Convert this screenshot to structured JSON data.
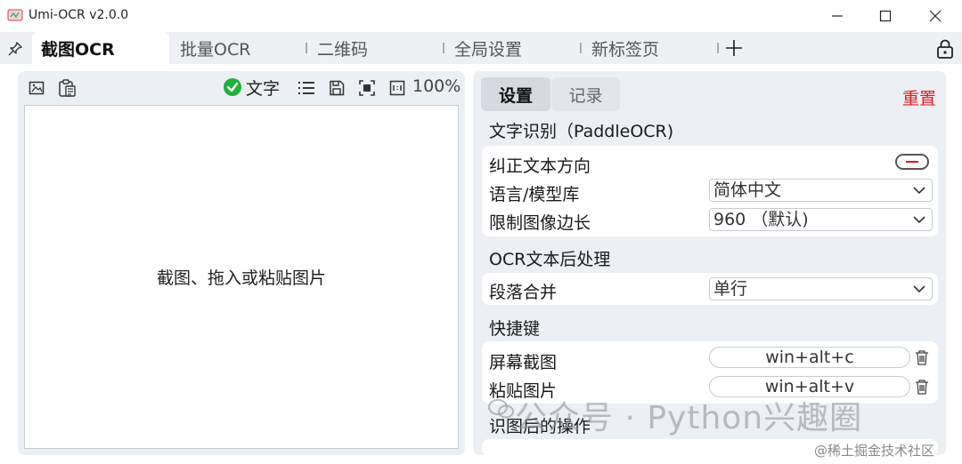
{
  "window": {
    "title": "Umi-OCR v2.0.0",
    "controls": [
      "minimize-icon",
      "maximize-icon",
      "close-icon"
    ]
  },
  "tabs": [
    {
      "label": "截图OCR",
      "active": true
    },
    {
      "label": "批量OCR",
      "active": false
    },
    {
      "label": "二维码",
      "active": false
    },
    {
      "label": "全局设置",
      "active": false
    },
    {
      "label": "新标签页",
      "active": false
    }
  ],
  "tabbar_icons": {
    "pin": "pin-icon",
    "add": "plus-icon",
    "lock": "lock-icon",
    "close": "close-icon"
  },
  "left_toolbar": {
    "screenshot_icon": "image-icon",
    "paste_icon": "clipboard-icon",
    "text_toggle_label": "文字",
    "text_toggle_checked": true,
    "list_icon": "list-icon",
    "save_icon": "save-icon",
    "fit_icon": "fit-screen-icon",
    "original_icon": "actual-size-icon",
    "zoom": "100%"
  },
  "image_area": {
    "hint": "截图、拖入或粘贴图片"
  },
  "right_tabs": [
    {
      "label": "设置",
      "active": true
    },
    {
      "label": "记录",
      "active": false
    }
  ],
  "reset_label": "重置",
  "settings": {
    "ocr_section_title": "文字识别（PaddleOCR)",
    "correct_direction_label": "纠正文本方向",
    "correct_direction_on": false,
    "language_label": "语言/模型库",
    "language_value": "简体中文",
    "limit_label": "限制图像边长",
    "limit_value": "960 （默认)",
    "post_section_title": "OCR文本后处理",
    "merge_label": "段落合并",
    "merge_value": "单行",
    "hotkey_section_title": "快捷键",
    "screenshot_hotkey_label": "屏幕截图",
    "screenshot_hotkey_value": "win+alt+c",
    "paste_hotkey_label": "粘贴图片",
    "paste_hotkey_value": "win+alt+v",
    "after_section_title": "识图后的操作"
  },
  "watermark": "公众号 · Python兴趣圈",
  "corner_credit": "@稀土掘金技术社区",
  "colors": {
    "accent_red": "#e21b1b",
    "check_green": "#1fb13a",
    "panel_bg": "#eceff3"
  }
}
